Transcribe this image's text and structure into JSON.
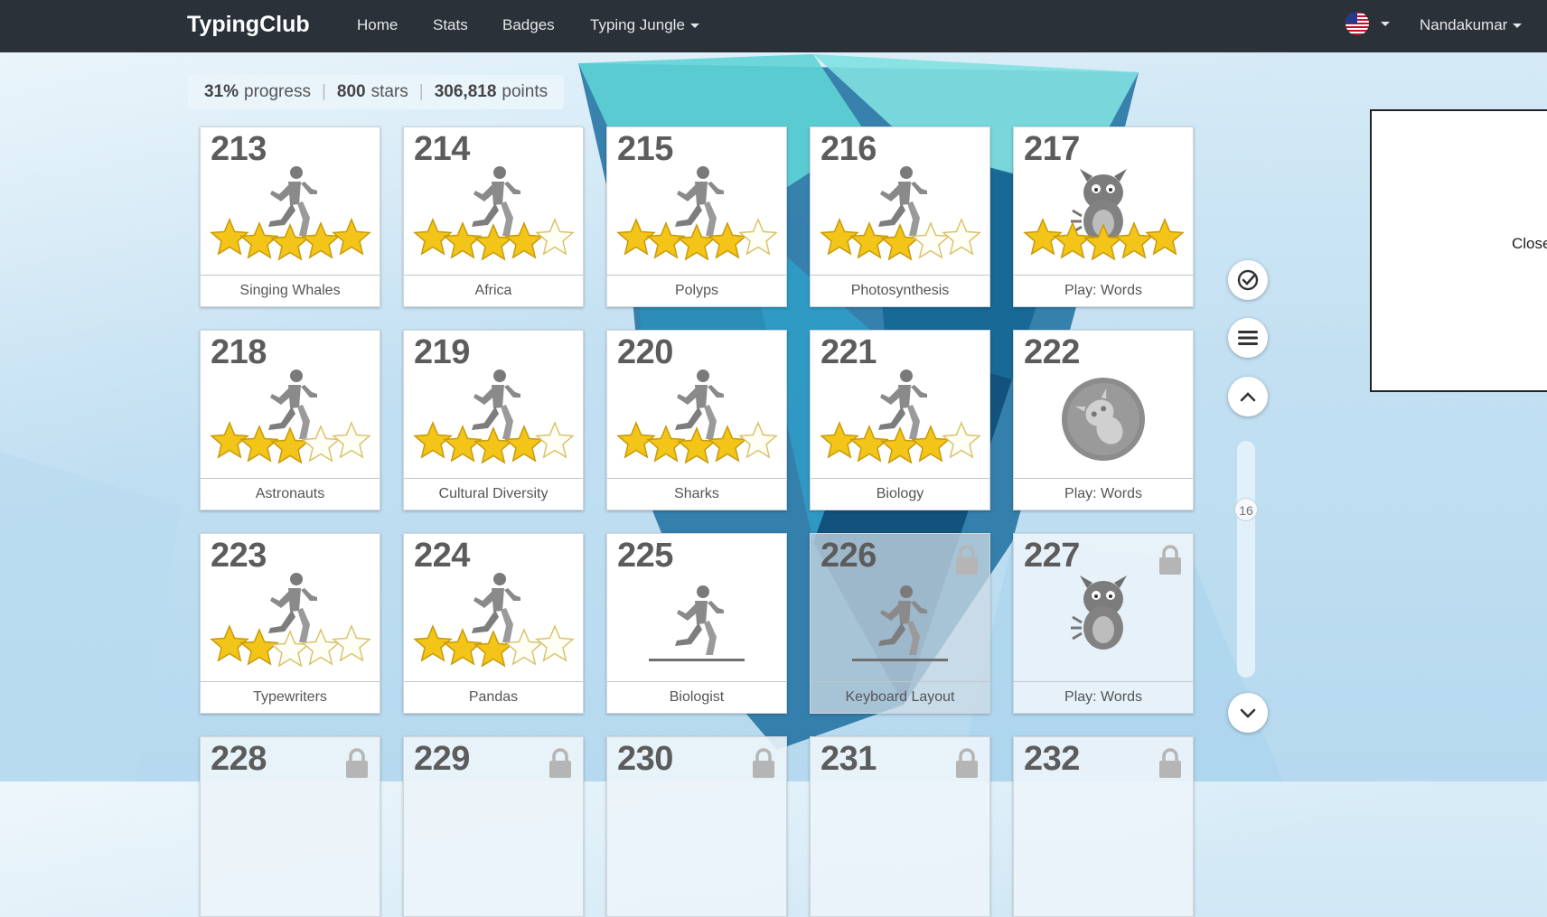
{
  "nav": {
    "brand": "TypingClub",
    "items": [
      "Home",
      "Stats",
      "Badges",
      "Typing Jungle"
    ],
    "user": "Nandakumar",
    "language_flag_icon": "us-flag-icon"
  },
  "stats": {
    "progress_value": "31%",
    "progress_label": "progress",
    "stars_value": "800",
    "stars_label": "stars",
    "points_value": "306,818",
    "points_label": "points"
  },
  "lessons": [
    {
      "num": "213",
      "label": "Singing Whales",
      "icon": "runner-icon",
      "stars": 5,
      "state": "done"
    },
    {
      "num": "214",
      "label": "Africa",
      "icon": "runner-icon",
      "stars": 4,
      "state": "done"
    },
    {
      "num": "215",
      "label": "Polyps",
      "icon": "runner-icon",
      "stars": 4,
      "state": "done"
    },
    {
      "num": "216",
      "label": "Photosynthesis",
      "icon": "runner-icon",
      "stars": 3,
      "state": "done"
    },
    {
      "num": "217",
      "label": "Play: Words",
      "icon": "monster-icon",
      "stars": 5,
      "state": "done"
    },
    {
      "num": "218",
      "label": "Astronauts",
      "icon": "runner-icon",
      "stars": 3,
      "state": "done"
    },
    {
      "num": "219",
      "label": "Cultural Diversity",
      "icon": "runner-icon",
      "stars": 4,
      "state": "done"
    },
    {
      "num": "220",
      "label": "Sharks",
      "icon": "runner-icon",
      "stars": 4,
      "state": "done"
    },
    {
      "num": "221",
      "label": "Biology",
      "icon": "runner-icon",
      "stars": 4,
      "state": "done"
    },
    {
      "num": "222",
      "label": "Play: Words",
      "icon": "monster-badge-icon",
      "stars": 0,
      "state": "done"
    },
    {
      "num": "223",
      "label": "Typewriters",
      "icon": "runner-icon",
      "stars": 2,
      "state": "done"
    },
    {
      "num": "224",
      "label": "Pandas",
      "icon": "runner-icon",
      "stars": 3,
      "state": "done"
    },
    {
      "num": "225",
      "label": "Biologist",
      "icon": "runner-track-icon",
      "stars": 0,
      "state": "open"
    },
    {
      "num": "226",
      "label": "Keyboard Layout",
      "icon": "runner-track-icon",
      "stars": 0,
      "state": "dim-locked"
    },
    {
      "num": "227",
      "label": "Play: Words",
      "icon": "monster-icon",
      "stars": 0,
      "state": "locked"
    },
    {
      "num": "228",
      "label": "",
      "icon": "",
      "stars": 0,
      "state": "locked"
    },
    {
      "num": "229",
      "label": "",
      "icon": "",
      "stars": 0,
      "state": "locked"
    },
    {
      "num": "230",
      "label": "",
      "icon": "",
      "stars": 0,
      "state": "locked"
    },
    {
      "num": "231",
      "label": "",
      "icon": "",
      "stars": 0,
      "state": "locked"
    },
    {
      "num": "232",
      "label": "",
      "icon": "",
      "stars": 0,
      "state": "locked"
    }
  ],
  "side": {
    "scroll_position": "16"
  },
  "panel": {
    "close_label": "Close"
  }
}
